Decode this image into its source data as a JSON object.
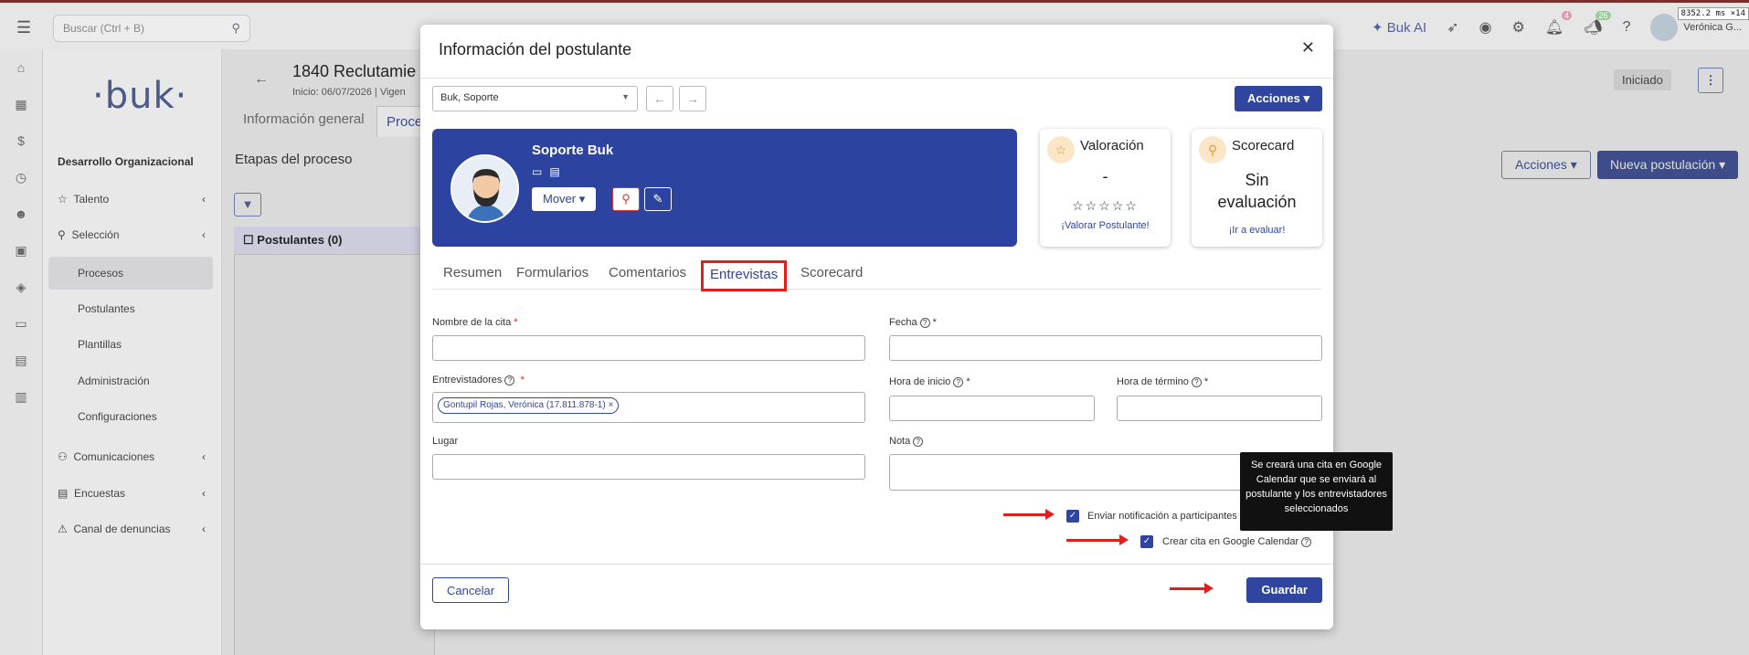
{
  "topbar": {
    "search_placeholder": "Buscar (Ctrl + B)",
    "buk_ai": "Buk AI",
    "bell_badge": "4",
    "megaphone_badge": "26",
    "user_name": "Verónica G...",
    "ms_tag": "8352.2 ms ×14"
  },
  "sidebar": {
    "logo": "·buk·",
    "section": "Desarrollo Organizacional",
    "items": [
      {
        "label": "Talento"
      },
      {
        "label": "Selección"
      },
      {
        "label": "Procesos"
      },
      {
        "label": "Postulantes"
      },
      {
        "label": "Plantillas"
      },
      {
        "label": "Administración"
      },
      {
        "label": "Configuraciones"
      },
      {
        "label": "Comunicaciones"
      },
      {
        "label": "Encuestas"
      },
      {
        "label": "Canal de denuncias"
      }
    ]
  },
  "background": {
    "title": "1840 Reclutamie",
    "subtitle": "Inicio: 06/07/2026  | Vigen",
    "tab_info": "Información general",
    "tab_proc": "Proce",
    "etapas": "Etapas del proceso",
    "column": "Postulantes (0)",
    "status": "Iniciado",
    "acciones": "Acciones",
    "nueva": "Nueva postulación"
  },
  "modal": {
    "title": "Información del postulante",
    "selector_value": "Buk, Soporte",
    "acciones": "Acciones",
    "candidate_name": "Soporte Buk",
    "mover": "Mover",
    "valoracion": {
      "title": "Valoración",
      "value": "-",
      "link": "¡Valorar Postulante!"
    },
    "scorecard": {
      "title": "Scorecard",
      "value_line1": "Sin",
      "value_line2": "evaluación",
      "link": "¡Ir a evaluar!"
    },
    "tabs": [
      "Resumen",
      "Formularios",
      "Comentarios",
      "Entrevistas",
      "Scorecard"
    ],
    "form": {
      "nombre_label": "Nombre de la cita",
      "fecha_label": "Fecha",
      "entrevistadores_label": "Entrevistadores",
      "entrevistador_chip": "Gontupil Rojas, Verónica (17.811.878-1)",
      "hora_inicio_label": "Hora de inicio",
      "hora_termino_label": "Hora de término",
      "lugar_label": "Lugar",
      "nota_label": "Nota",
      "notificacion_label": "Enviar notificación a participantes de la cita",
      "google_label": "Crear cita en Google Calendar",
      "tooltip": "Se creará una cita en Google Calendar que se enviará al postulante y los entrevistadores seleccionados"
    },
    "cancelar": "Cancelar",
    "guardar": "Guardar"
  }
}
